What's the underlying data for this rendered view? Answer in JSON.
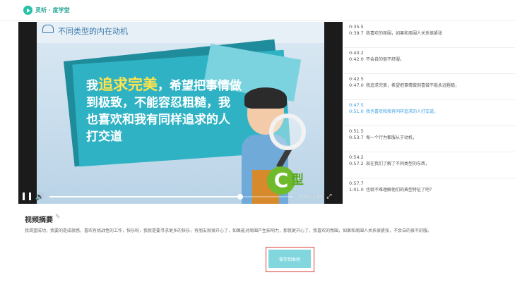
{
  "app": {
    "brand": "灵听 · 度学堂",
    "accent": "#27c2a8"
  },
  "video": {
    "scene_title": "不同类型的内在动机",
    "scene_text": {
      "lead": "我",
      "highlight": "追求完美",
      "rest": "，希望把事情做到极致，不能容忍粗糙，我也喜欢和我有同样追求的人打交道"
    },
    "badge_letter": "C",
    "badge_text": "型",
    "time": "0:48 / 1:04",
    "progress_fraction": 0.78
  },
  "transcript": [
    {
      "start": "0:35.5",
      "end": "0:39.7",
      "text": "我喜欢的氛围，如果和周围人关系很紧张",
      "active": false
    },
    {
      "start": "0:40.2",
      "end": "0:42.0",
      "text": "不会自的很不舒服。",
      "active": false
    },
    {
      "start": "0:42.5",
      "end": "0:47.0",
      "text": "我追求完美，希望把事情做到喜做不能永远粗糙，",
      "active": false
    },
    {
      "start": "0:47.5",
      "end": "0:51.0",
      "text": "我也喜欢和我有同样追求的人打交道。",
      "active": true
    },
    {
      "start": "0:51.5",
      "end": "0:53.7",
      "text": "每一个行为都服从于动机，",
      "active": false
    },
    {
      "start": "0:54.2",
      "end": "0:57.2",
      "text": "现在我们了解了不同类型的东西，",
      "active": false
    },
    {
      "start": "0:57.7",
      "end": "1:01.0",
      "text": "也就不难理解他们的典型特征了吧？",
      "active": false
    }
  ],
  "summary": {
    "title": "视频摘要",
    "text": "我渴望成功，我要的是成就感，喜欢有挑战性的工作，快乐呀，我就是要寻求更多的快乐，有朋友就很开心了，如果能对周围产生影响力，那就更开心了，我喜欢的氛围，如果和周围人关系很紧张，不会自的很不舒服。"
  },
  "actions": {
    "save_label": "保存到本地"
  }
}
